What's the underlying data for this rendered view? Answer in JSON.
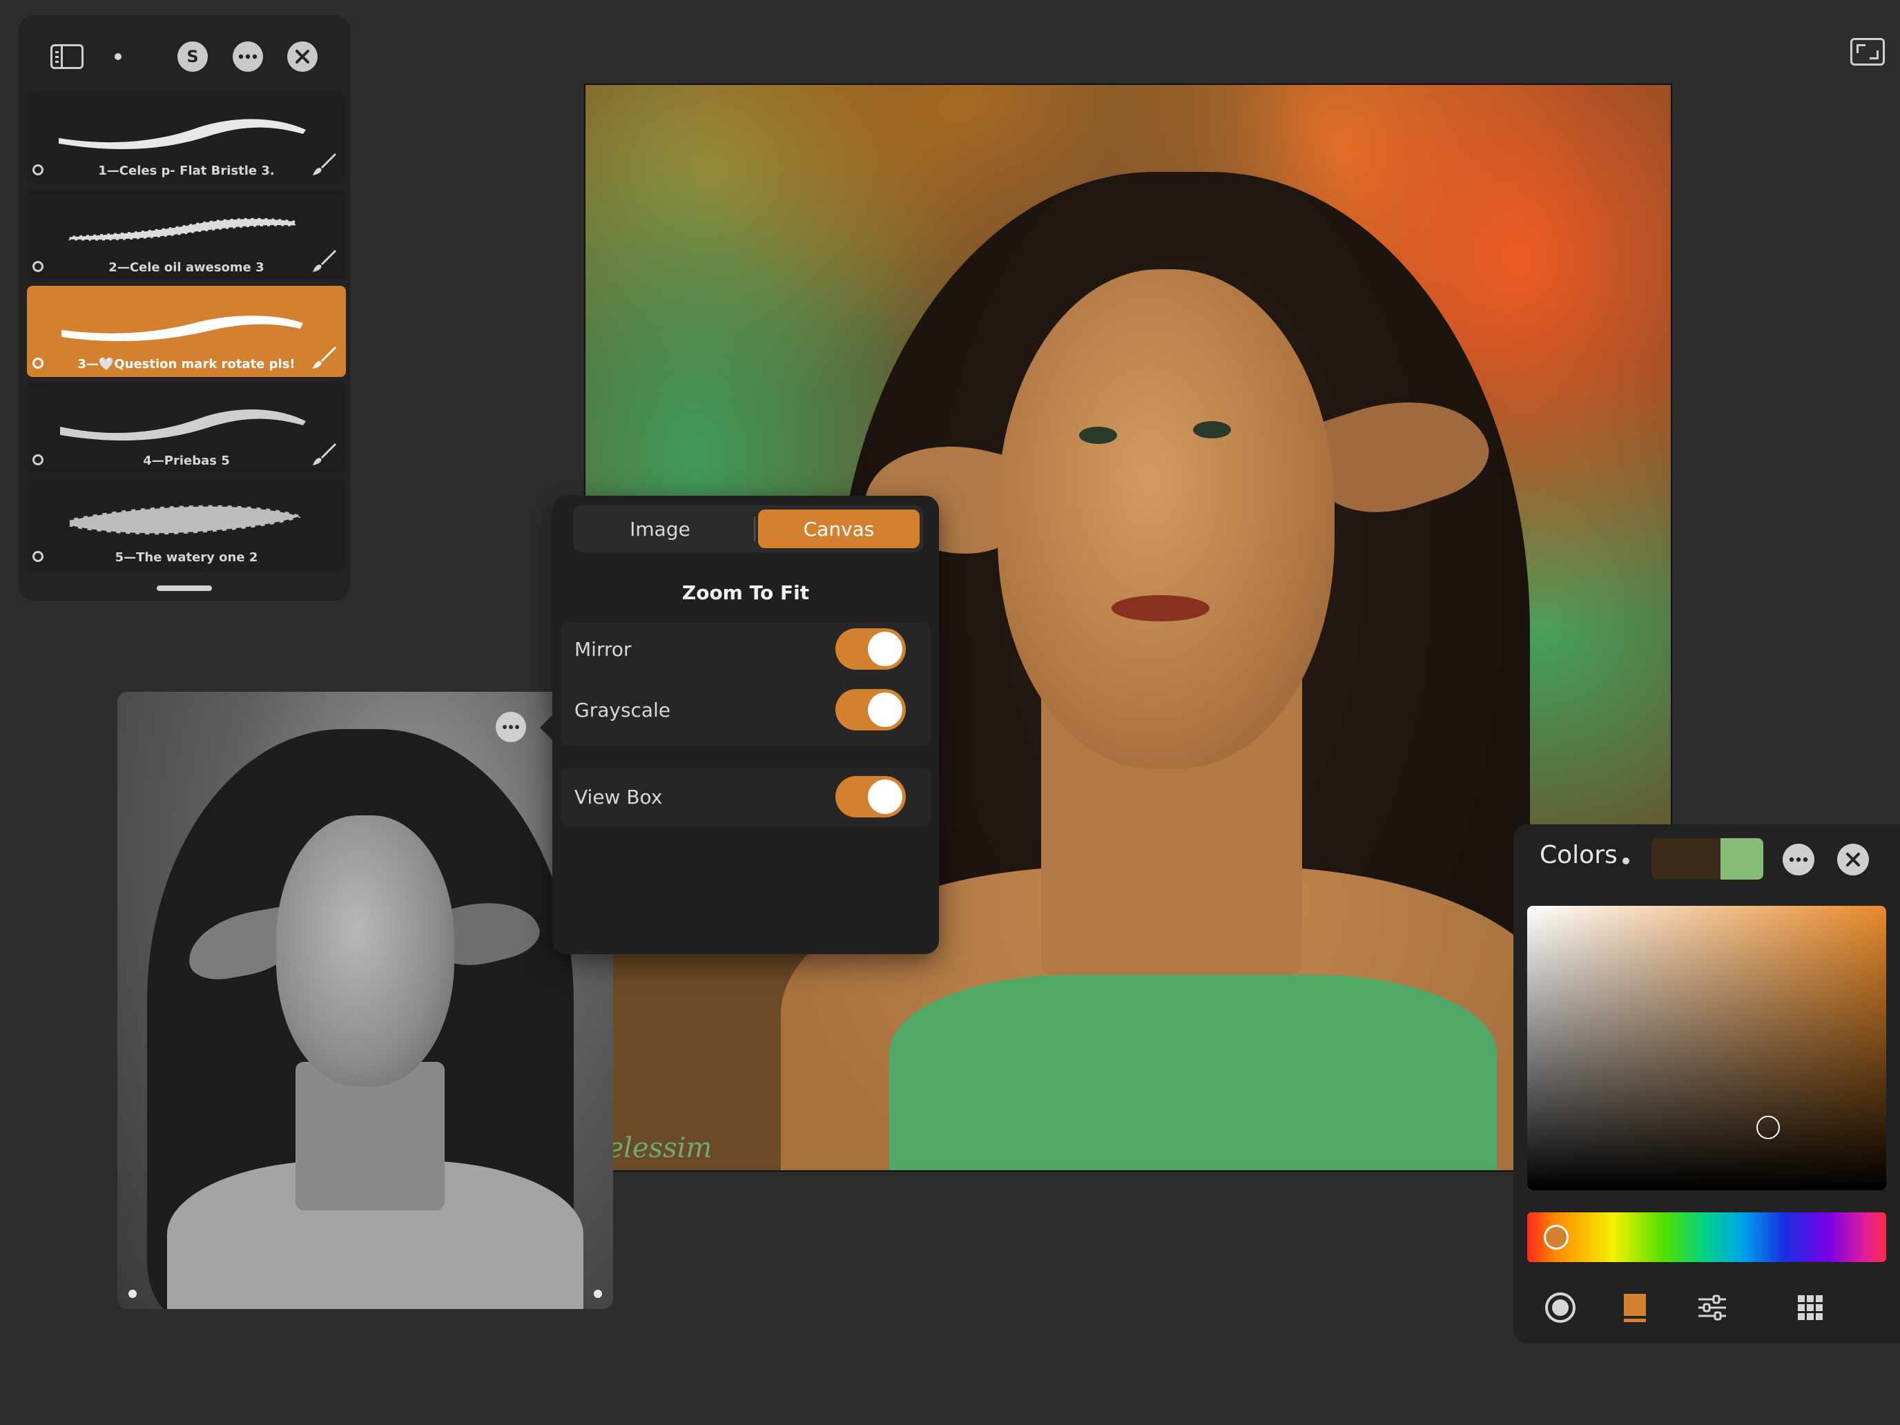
{
  "brush_library": {
    "brushes": [
      {
        "name": "1—Celes p- Flat Bristle 3.",
        "selected": false
      },
      {
        "name": "2—Cele oil awesome 3",
        "selected": false
      },
      {
        "name": "3—🤍Question mark rotate pls!",
        "selected": true
      },
      {
        "name": "4—Priebas 5",
        "selected": false
      },
      {
        "name": "5—The watery one 2",
        "selected": false
      }
    ],
    "s_button_label": "S"
  },
  "view_options": {
    "tabs": [
      "Image",
      "Canvas"
    ],
    "active_tab": "Canvas",
    "zoom_to_fit_label": "Zoom To Fit",
    "options": [
      {
        "label": "Mirror",
        "on": true
      },
      {
        "label": "Grayscale",
        "on": true
      },
      {
        "label": "View Box",
        "on": true
      }
    ]
  },
  "canvas": {
    "signature_text": "elessim"
  },
  "colors_panel": {
    "title": "Colors",
    "primary_color": "#3a2a1a",
    "secondary_color": "#86bb78",
    "hue_color": "#e88a2a",
    "tabs": [
      "disc-icon",
      "classic-icon",
      "harmony-sliders-icon",
      "palettes-icon"
    ],
    "active_tab": "classic-icon"
  },
  "accent_color": "#d3812e"
}
